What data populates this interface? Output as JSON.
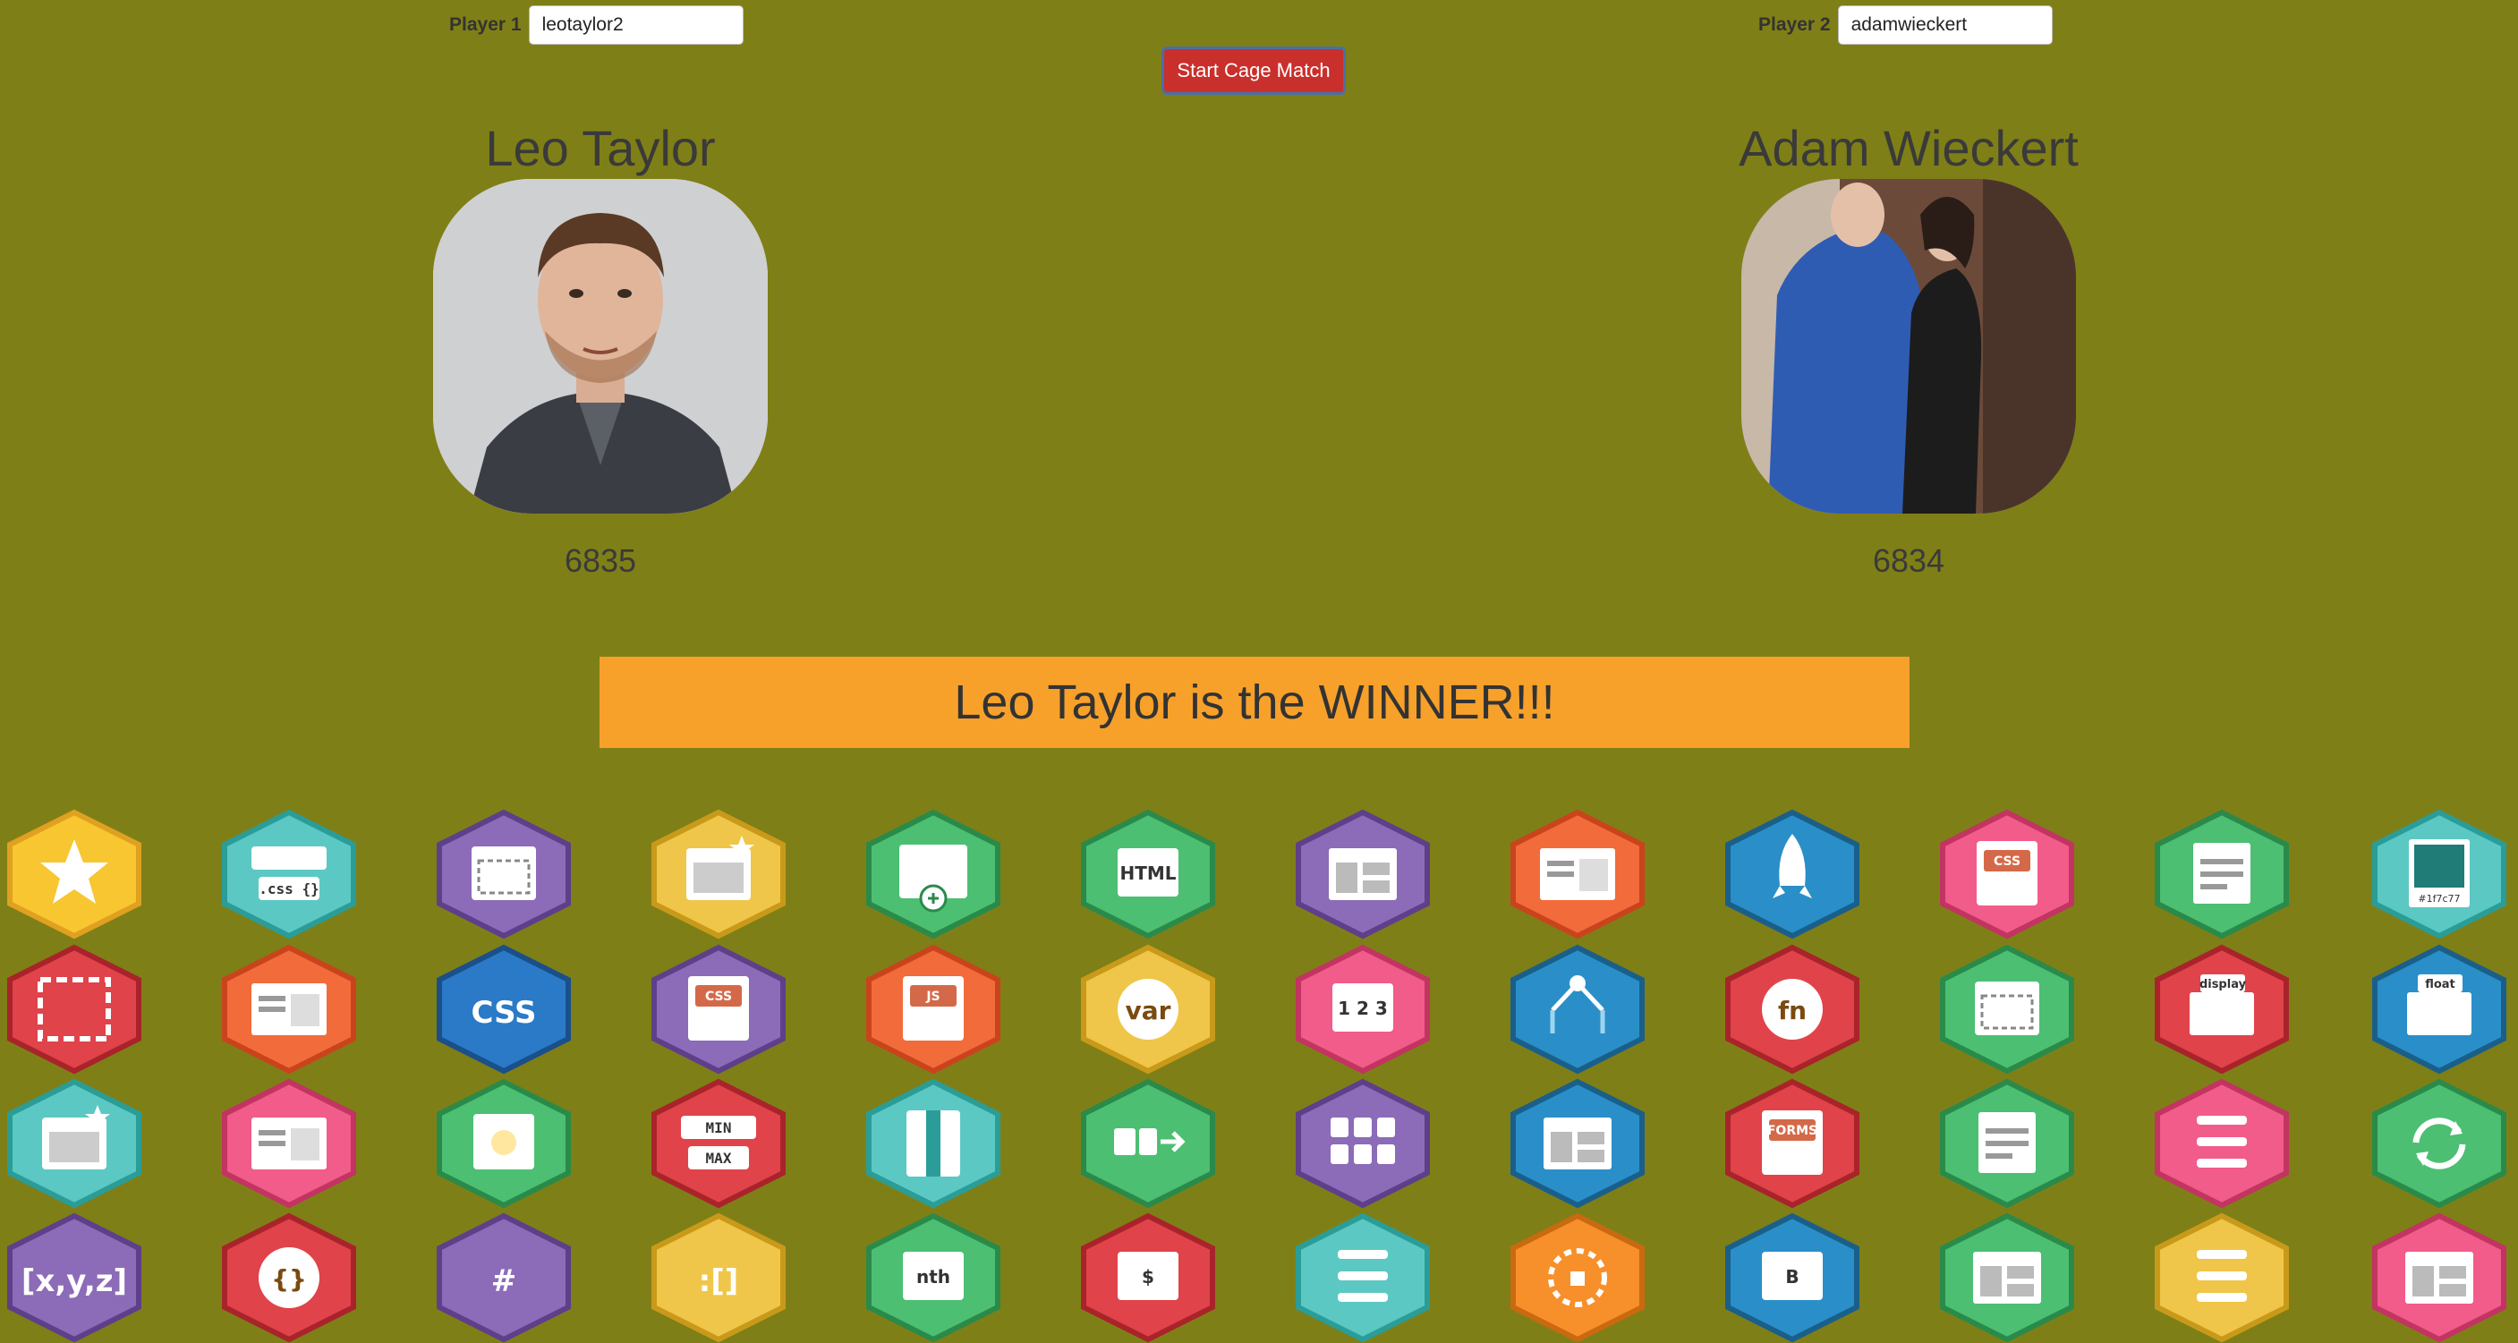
{
  "players": [
    {
      "label": "Player 1",
      "input_value": "leotaylor2",
      "name": "Leo Taylor",
      "score": "6835"
    },
    {
      "label": "Player 2",
      "input_value": "adamwieckert",
      "name": "Adam Wieckert",
      "score": "6834"
    }
  ],
  "start_button_label": "Start Cage Match",
  "winner_text": "Leo Taylor is the WINNER!!!",
  "badge_texts": {
    "html": "<html>",
    "css": ".css {}",
    "html2": "HTML",
    "css_logo": "CSS",
    "css_book": "CSS",
    "js": "JS",
    "var": "var",
    "nums": "1 2 3",
    "fn": "fn",
    "display": "display",
    "float": "float",
    "hex": "#1f7c77",
    "min": "MIN",
    "max": "MAX",
    "forms": "FORMS",
    "xyz": "[x,y,z]",
    "braces": "{}",
    "arr": ":[]",
    "nth": "nth",
    "dollar": "$",
    "b": "B",
    "code": "<>"
  },
  "colors": {
    "background": "#7f7f17",
    "banner": "#f7a12a",
    "button": "#c9302c"
  }
}
